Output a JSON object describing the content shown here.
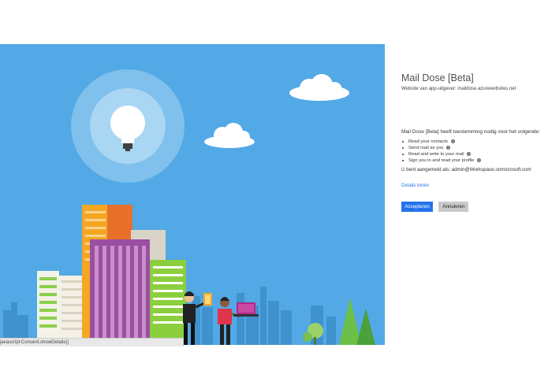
{
  "app": {
    "title": "Mail Dose [Beta]",
    "publisher": "Website van app-uitgever: maildose.azurewebsites.net"
  },
  "permissions": {
    "intro": "Mail Dose [Beta] heeft toestemming nodig voor het volgende:",
    "items": [
      {
        "label": "Read your contacts"
      },
      {
        "label": "Send mail as you"
      },
      {
        "label": "Read and write to your mail"
      },
      {
        "label": "Sign you in and read your profile"
      }
    ],
    "help_glyph": "?"
  },
  "account": {
    "signed_in_text": "U bent aangemeld als: admin@Workspace.onmicrosoft.com"
  },
  "links": {
    "details": "Details tonen"
  },
  "buttons": {
    "accept": "Accepteren",
    "cancel": "Annuleren"
  },
  "status_bar": {
    "text": "javascript:Consent.showDetails()"
  },
  "colors": {
    "hero_sky": "#52a9e5",
    "accent_blue": "#2672ec",
    "cancel_gray": "#c8c8c8"
  },
  "icons": [
    "lightbulb-icon",
    "cloud-icon",
    "help-icon",
    "tablet-icon",
    "laptop-icon"
  ]
}
